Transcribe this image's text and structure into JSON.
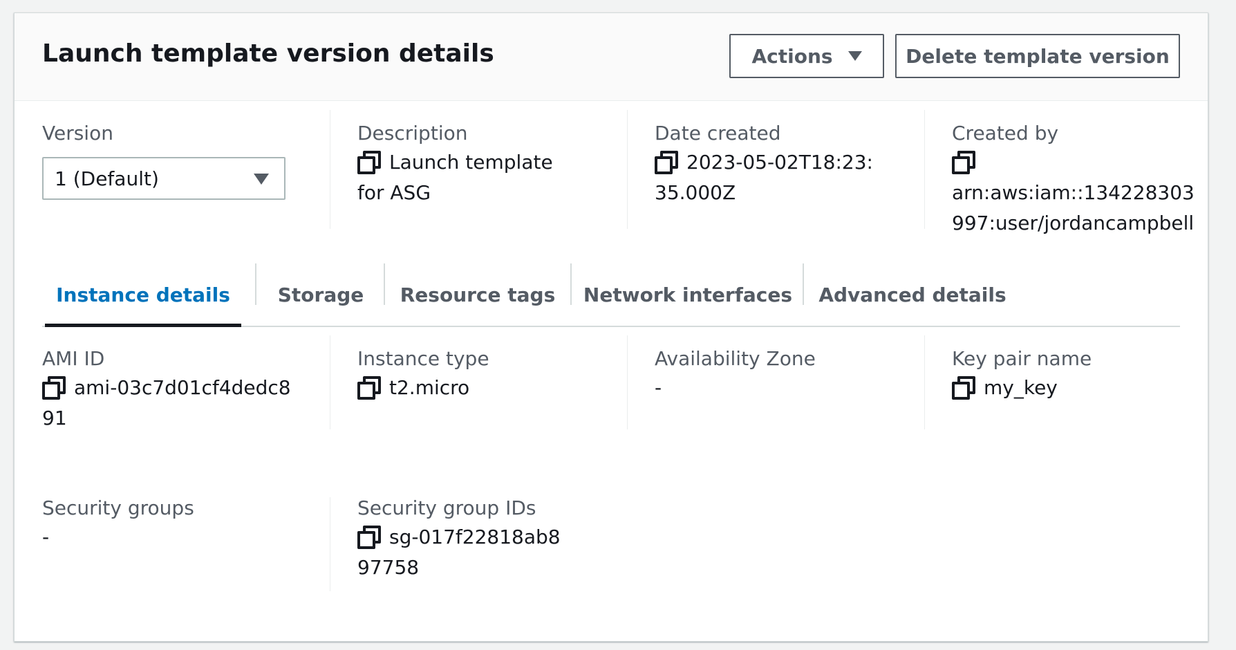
{
  "header": {
    "title": "Launch template version details",
    "actions_label": "Actions",
    "delete_label": "Delete template version"
  },
  "summary": {
    "version": {
      "label": "Version",
      "selected": "1 (Default)"
    },
    "description": {
      "label": "Description",
      "value": "Launch template for ASG"
    },
    "date_created": {
      "label": "Date created",
      "value": "2023-05-02T18:23:35.000Z"
    },
    "created_by": {
      "label": "Created by",
      "value": "arn:aws:iam::134228303997:user/jordancampbell"
    }
  },
  "tabs": [
    {
      "label": "Instance details",
      "active": true
    },
    {
      "label": "Storage",
      "active": false
    },
    {
      "label": "Resource tags",
      "active": false
    },
    {
      "label": "Network interfaces",
      "active": false
    },
    {
      "label": "Advanced details",
      "active": false
    }
  ],
  "details": {
    "ami_id": {
      "label": "AMI ID",
      "value": "ami-03c7d01cf4dedc891"
    },
    "instance_type": {
      "label": "Instance type",
      "value": "t2.micro"
    },
    "availability_zone": {
      "label": "Availability Zone",
      "value": "-"
    },
    "key_pair": {
      "label": "Key pair name",
      "value": "my_key"
    },
    "security_groups": {
      "label": "Security groups",
      "value": "-"
    },
    "security_group_ids": {
      "label": "Security group IDs",
      "value": "sg-017f22818ab897758"
    }
  },
  "icons": {
    "copy": "copy-icon",
    "dropdown": "caret-down-icon"
  },
  "colors": {
    "active_tab": "#0073bb",
    "text": "#16191f",
    "muted": "#545b64"
  }
}
